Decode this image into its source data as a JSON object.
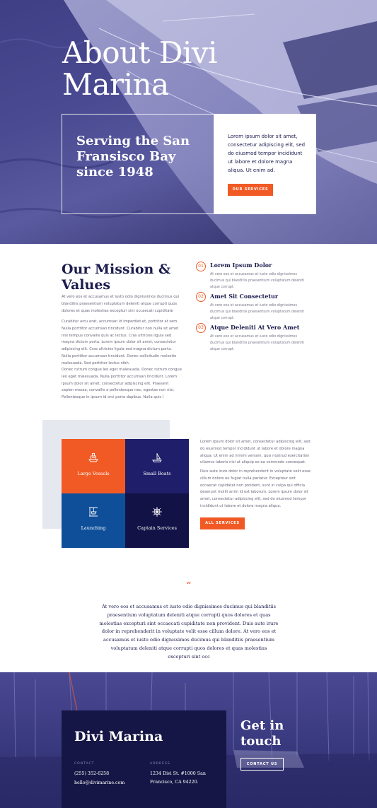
{
  "colors": {
    "navy": "#1c1c4e",
    "accent": "#f15a24",
    "hero_purple": "#4a4a92",
    "tile_orange": "#f15a24",
    "tile_indigo": "#1e1e6a",
    "tile_blue": "#0f4f9a",
    "tile_dark": "#121246"
  },
  "hero": {
    "title": "About Divi Marina",
    "box_title": "Serving the San Fransisco Bay since 1948",
    "card_text": "Lorem ipsum dolor sit amet, consectetur adipiscing elit, sed do eiusmod tempor incididunt ut labore et dolore magna aliqua. Ut enim ad.",
    "button": "OUR SERVICES"
  },
  "mission": {
    "title": "Our Mission & Values",
    "paragraphs": [
      "At vero eos et accusamus et iusto odio dignissimos ducimus qui blanditiis praesentium voluptatum deleniti atque corrupti quos dolores et quas molestias excepturi sint occaecati cupiditate",
      "Curabitur arcu erat, accumsan id imperdiet et, porttitor at sem. Nulla porttitor accumsan tincidunt. Curabitur non nulla sit amet nisl tempus convallis quis ac lectus. Cras ultricies ligula sed magna dictum porta. Lorem ipsum dolor sit amet, consectetur adipiscing elit. Cras ultricies ligula sed magna dictum porta. Nulla porttitor accumsan tincidunt. Donec sollicitudin molestie malesuada. Sed porttitor lectus nibh.",
      "Donec rutrum congue leo eget malesuada. Donec rutrum congue leo eget malesuada. Nulla porttitor accumsan tincidunt. Lorem ipsum dolor sit amet, consectetur adipiscing elit. Praesent sapien massa, convallis a pellentesque nec, egestas non nisi. Pellentesque in ipsum id orci porta dapibus. Nulla quis l"
    ],
    "items": [
      {
        "num": "01",
        "title": "Lorem Ipsum Dolor",
        "text": "At vero eos et accusamus et iusto odio dignissimos ducimus qui blanditiis praesentium voluptatum deleniti atque corrupt."
      },
      {
        "num": "02",
        "title": "Amet Sit Consectetur",
        "text": "At vero eos et accusamus et iusto odio dignissimos ducimus qui blanditiis praesentium voluptatum deleniti atque corrupt."
      },
      {
        "num": "03",
        "title": "Atque Deleniti At Vero Amet",
        "text": "At vero eos et accusamus et iusto odio dignissimos ducimus qui blanditiis praesentium voluptatum deleniti atque corrupt."
      }
    ]
  },
  "services": {
    "tiles": [
      {
        "label": "Large Vessels",
        "icon": "ship-icon"
      },
      {
        "label": "Small Boats",
        "icon": "sailboat-icon"
      },
      {
        "label": "Launching",
        "icon": "boat-lift-icon"
      },
      {
        "label": "Captain Services",
        "icon": "ship-wheel-icon"
      }
    ],
    "paragraphs": [
      "Lorem ipsum dolor sit amet, consectetur adipiscing elit, sed do eiusmod tempor incididunt ut labore et dolore magna aliqua. Ut enim ad minim veniam, quis nostrud exercitation ullamco laboris nisi ut aliquip ex ea commodo consequat.",
      "Duis aute irure dolor in reprehenderit in voluptate velit esse cillum dolore eu fugiat nulla pariatur. Excepteur sint occaecat cupidatat non proident, sunt in culpa qui officia deserunt mollit anim id est laborum. Lorem ipsum dolor sit amet, consectetur adipiscing elit, sed do eiusmod tempor incididunt ut labore et dolore magna aliqua."
    ],
    "button": "ALL SERVICES"
  },
  "quote": {
    "mark": "“",
    "text": "At vero eos et accusamus et iusto odio dignissimos ducimus qui blanditiis praesentium voluptatum deleniti atque corrupti quos dolores et quas molestias excepturi sint occaecati cupiditate non provident. Duis aute irure dolor in reprehenderit in voluptate velit esse cillum dolore. At vero eos et accusamus et iusto odio dignissimos ducimus qui blanditiis praesentium voluptatum deleniti atque corrupti quos dolores et quas molestias excepturi sint occ"
  },
  "footer": {
    "brand": "Divi Marina",
    "contact_label": "CONTACT",
    "phone": "(255) 352-6258",
    "email": "hello@divimarine.com",
    "address_label": "ADDRESS",
    "address_line1": "1234 Divi St. #1000 San",
    "address_line2": "Francisco, CA 94220.",
    "cta_title": "Get in touch",
    "cta_button": "CONTACT US"
  }
}
